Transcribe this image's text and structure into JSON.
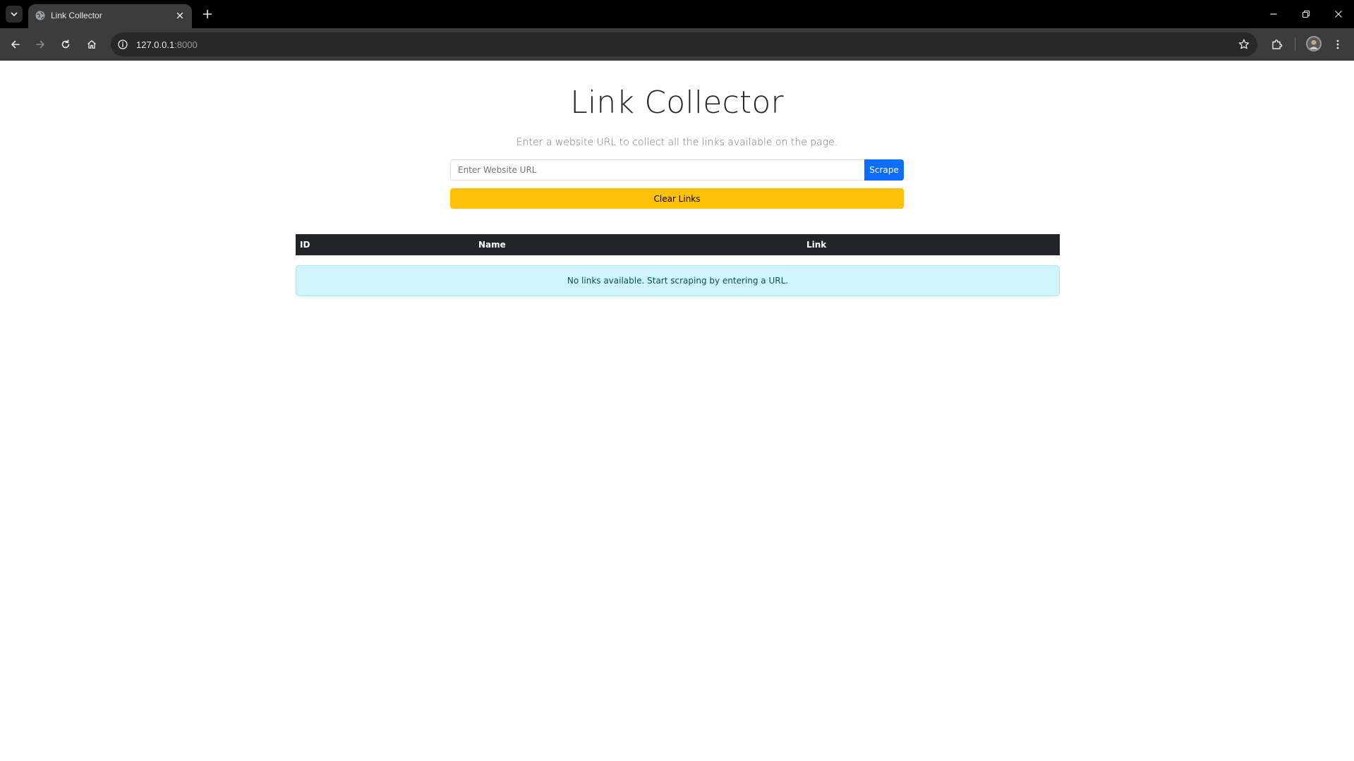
{
  "browser": {
    "tab": {
      "title": "Link Collector"
    },
    "address": {
      "host": "127.0.0.1",
      "port": ":8000"
    }
  },
  "page": {
    "title": "Link Collector",
    "subtitle": "Enter a website URL to collect all the links available on the page.",
    "url_input": {
      "placeholder": "Enter Website URL",
      "value": ""
    },
    "scrape_label": "Scrape",
    "clear_label": "Clear Links",
    "table": {
      "columns": [
        "ID",
        "Name",
        "Link"
      ],
      "rows": []
    },
    "empty_message": "No links available. Start scraping by entering a URL."
  },
  "colors": {
    "primary": "#0d6efd",
    "warning": "#ffc107",
    "table_header": "#212529",
    "info_bg": "#cff4fc",
    "info_text": "#055160"
  }
}
